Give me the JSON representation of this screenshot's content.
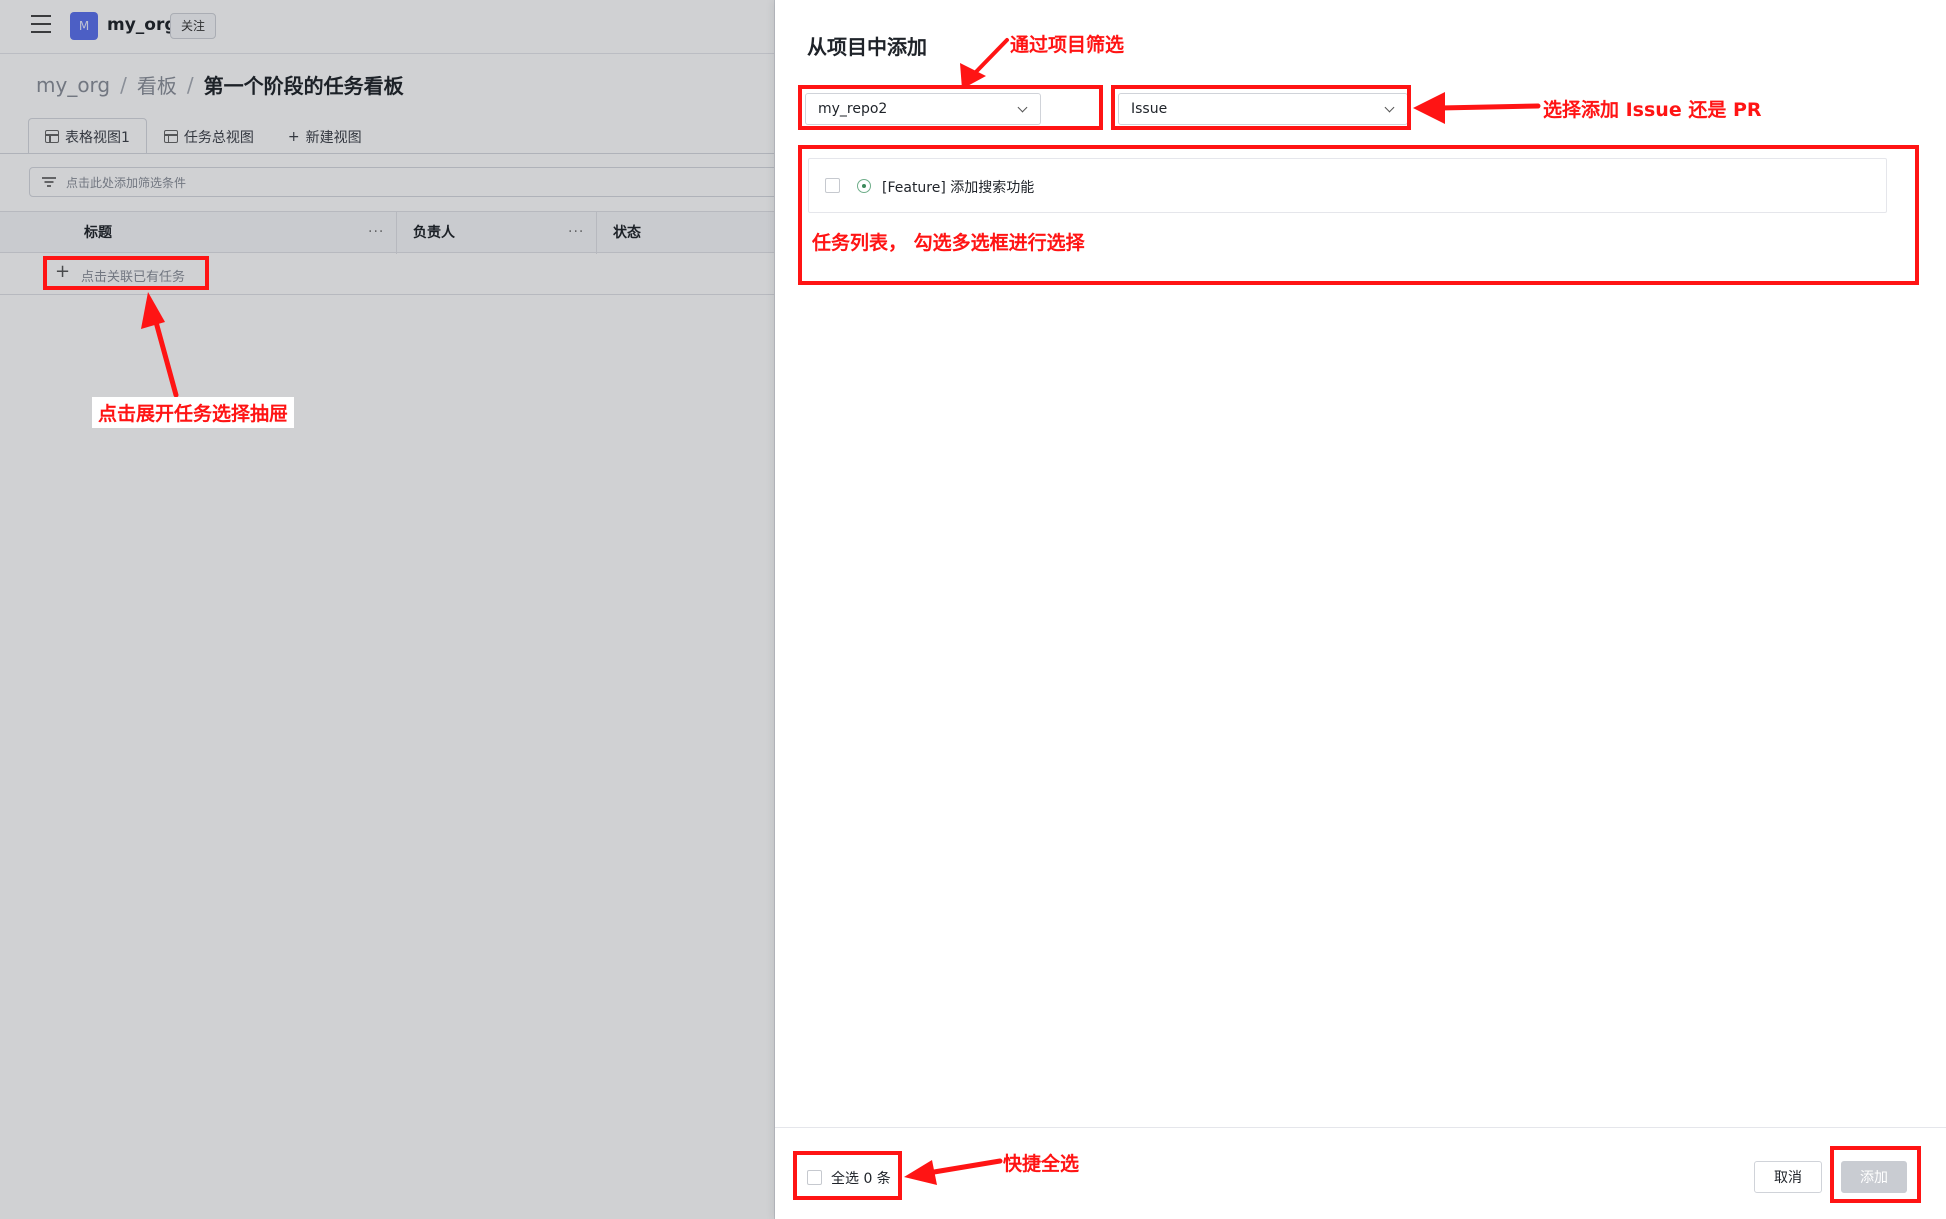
{
  "app": {
    "org_avatar_letter": "M",
    "org_name": "my_org",
    "follow_label": "关注",
    "breadcrumb": [
      "my_org",
      "看板",
      "第一个阶段的任务看板"
    ],
    "breadcrumb_sep": "/",
    "tabs": [
      {
        "label": "表格视图1",
        "icon": "table-icon",
        "active": true
      },
      {
        "label": "任务总视图",
        "icon": "table-icon",
        "active": false
      },
      {
        "label": "新建视图",
        "icon": "plus-icon",
        "active": false
      }
    ],
    "new_view_plus": "+",
    "filter_placeholder": "点击此处添加筛选条件",
    "columns": [
      "标题",
      "负责人",
      "状态"
    ],
    "column_more": "···",
    "add_row_plus": "+",
    "add_row_label": "点击关联已有任务"
  },
  "drawer": {
    "title": "从项目中添加",
    "repo_select_value": "my_repo2",
    "type_select_value": "Issue",
    "tasks": [
      {
        "title": "[Feature] 添加搜索功能",
        "checked": false,
        "status_icon": "issue-open-icon"
      }
    ],
    "select_all_label": "全选 0 条",
    "cancel_label": "取消",
    "add_label": "添加"
  },
  "annotations": {
    "repo_filter": "通过项目筛选",
    "type_choice": "选择添加 Issue 还是 PR",
    "task_list": "任务列表， 勾选多选框进行选择",
    "open_drawer": "点击展开任务选择抽屉",
    "select_all": "快捷全选"
  },
  "colors": {
    "annotation": "#ff1414",
    "avatar": "#5b71ee",
    "status_open": "#3c8a5b",
    "disabled_button": "#c9ccd2"
  }
}
